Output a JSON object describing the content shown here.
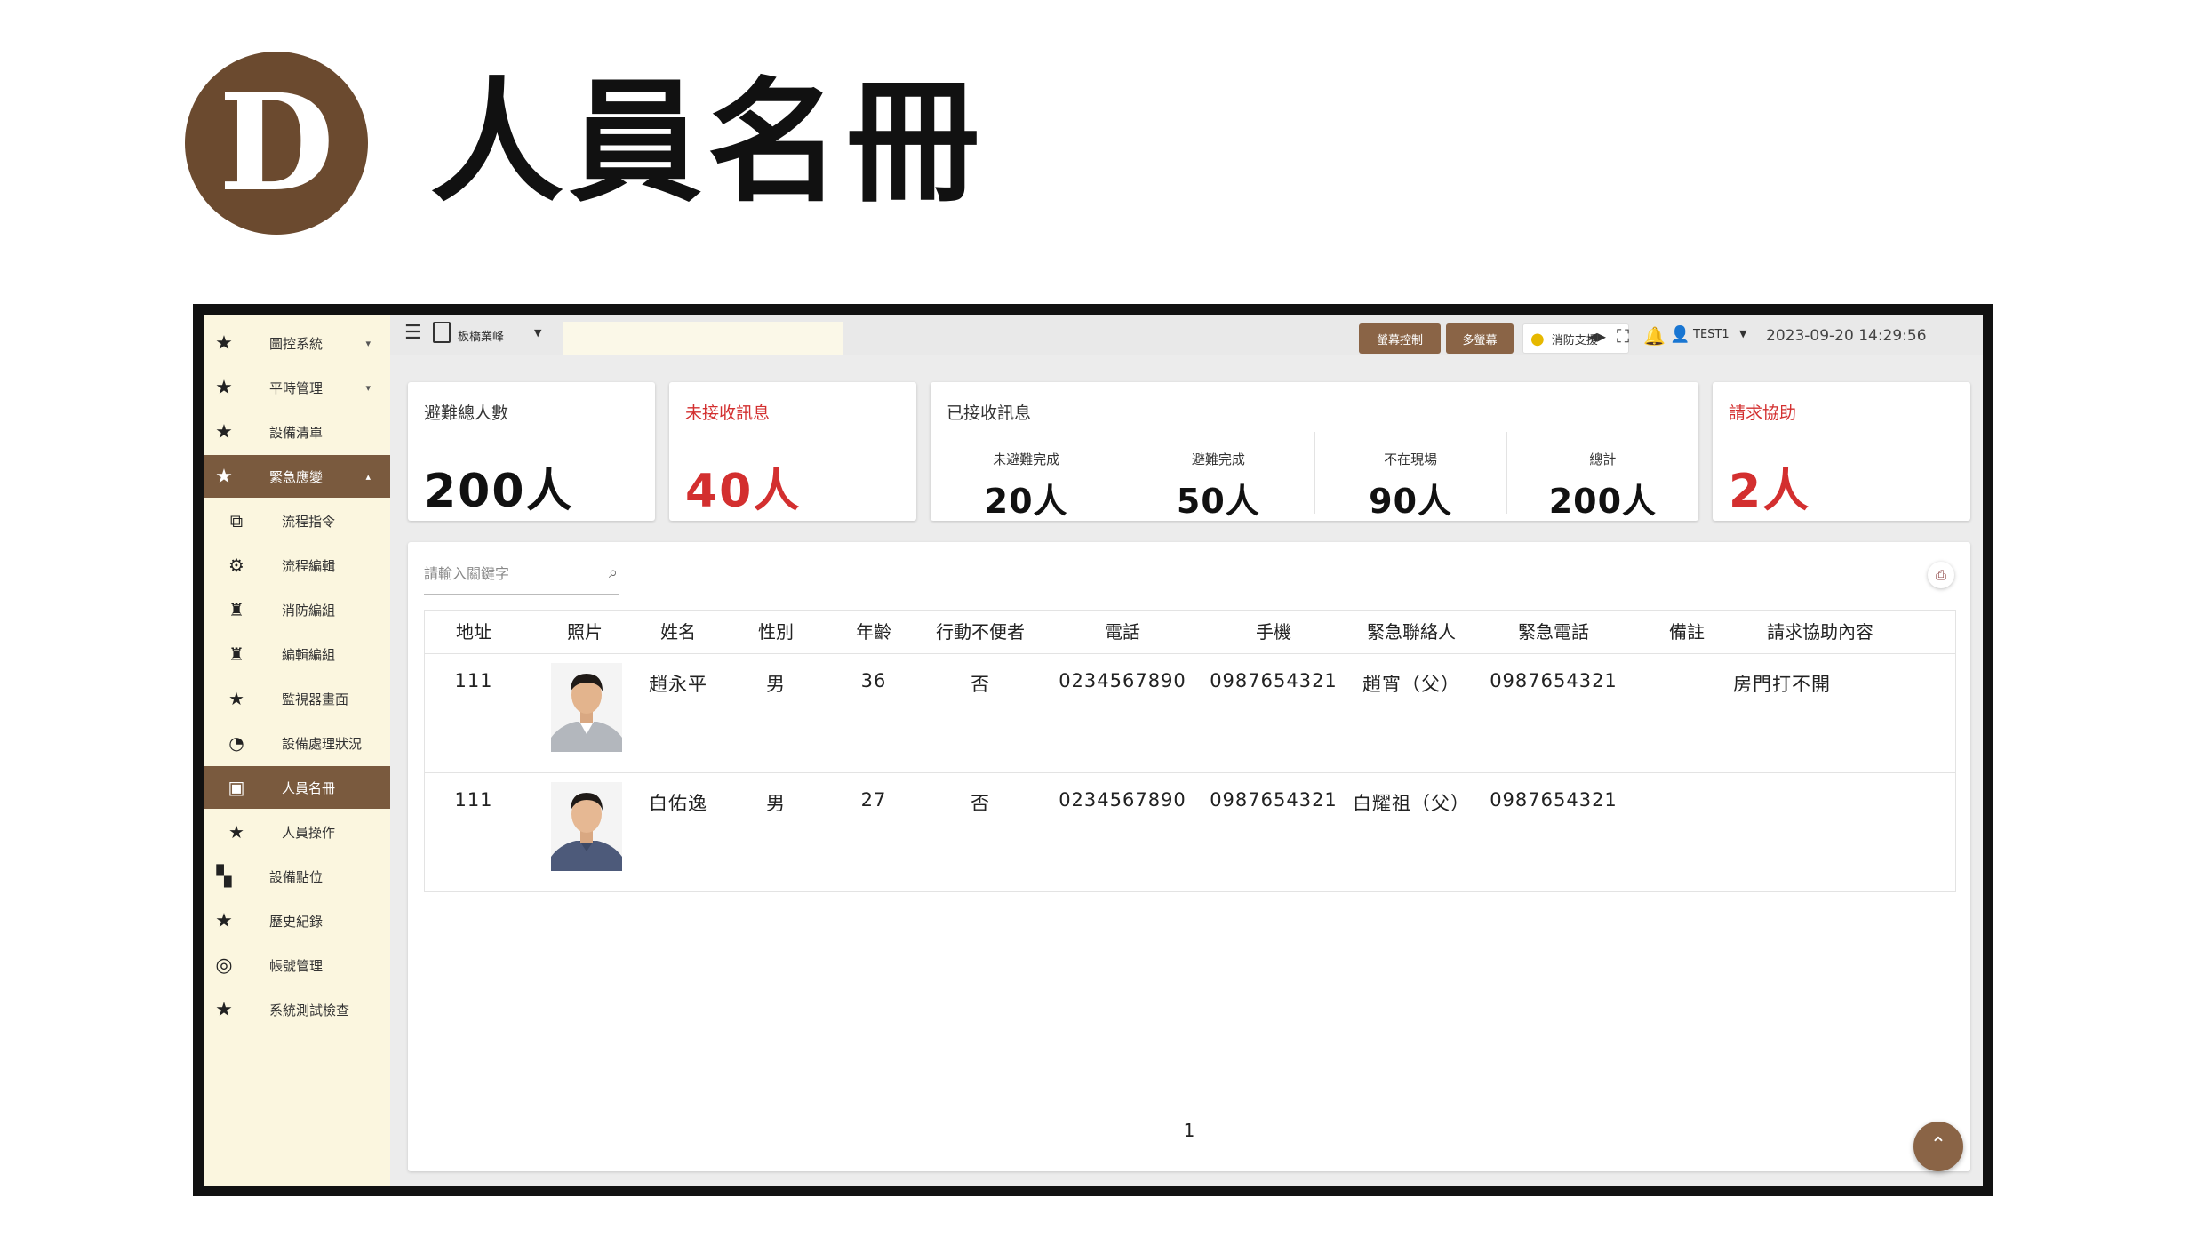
{
  "heading": {
    "badge": "D",
    "title": "人員名冊"
  },
  "sidebar": {
    "items": [
      {
        "label": "圖控系統",
        "caret": "▾",
        "icon": "star-icon"
      },
      {
        "label": "平時管理",
        "caret": "▾",
        "icon": "star-icon"
      },
      {
        "label": "設備清單",
        "icon": "star-icon"
      },
      {
        "label": "緊急應變",
        "caret": "▴",
        "icon": "star-icon"
      },
      {
        "label": "流程指令",
        "icon": "flow-command-icon"
      },
      {
        "label": "流程編輯",
        "icon": "flow-edit-icon"
      },
      {
        "label": "消防編組",
        "icon": "firefighter-icon"
      },
      {
        "label": "編輯編組",
        "icon": "firefighter-icon"
      },
      {
        "label": "監視器畫面",
        "icon": "star-icon"
      },
      {
        "label": "設備處理狀況",
        "icon": "status-cycle-icon"
      },
      {
        "label": "人員名冊",
        "icon": "roster-icon"
      },
      {
        "label": "人員操作",
        "icon": "star-icon"
      },
      {
        "label": "設備點位",
        "icon": "equipment-point-icon"
      },
      {
        "label": "歷史紀錄",
        "icon": "star-icon"
      },
      {
        "label": "帳號管理",
        "icon": "account-icon"
      },
      {
        "label": "系統測試檢查",
        "icon": "star-icon"
      }
    ]
  },
  "topbar": {
    "site_label": "板橋業峰",
    "screen_control": "螢幕控制",
    "multi_screen": "多螢幕",
    "fire_support": "消防支援",
    "user": "TEST1",
    "datetime": "2023-09-20 14:29:56"
  },
  "cards": {
    "total": {
      "title": "避難總人數",
      "value": "200人"
    },
    "unreceived": {
      "title": "未接收訊息",
      "value": "40人"
    },
    "received": {
      "title": "已接收訊息",
      "cols": [
        {
          "label": "未避難完成",
          "value": "20人"
        },
        {
          "label": "避難完成",
          "value": "50人"
        },
        {
          "label": "不在現場",
          "value": "90人"
        },
        {
          "label": "總計",
          "value": "200人"
        }
      ]
    },
    "assist": {
      "title": "請求協助",
      "value": "2人"
    }
  },
  "search": {
    "placeholder": "請輸入關鍵字"
  },
  "table": {
    "headers": [
      "地址",
      "照片",
      "姓名",
      "性別",
      "年齡",
      "行動不便者",
      "電話",
      "手機",
      "緊急聯絡人",
      "緊急電話",
      "備註",
      "請求協助內容"
    ],
    "rows": [
      {
        "address": "111",
        "name": "趙永平",
        "gender": "男",
        "age": "36",
        "disabled": "否",
        "phone": "0234567890",
        "mobile": "0987654321",
        "contact": "趙宵（父）",
        "contact_phone": "0987654321",
        "note": "",
        "request": "房門打不開"
      },
      {
        "address": "111",
        "name": "白佑逸",
        "gender": "男",
        "age": "27",
        "disabled": "否",
        "phone": "0234567890",
        "mobile": "0987654321",
        "contact": "白耀祖（父）",
        "contact_phone": "0987654321",
        "note": "",
        "request": ""
      }
    ]
  },
  "pagination": {
    "page": "1"
  },
  "colors": {
    "brand_brown": "#7a5a3e",
    "sidebar_bg": "#fbf6df",
    "alert_red": "#d32f2f"
  }
}
